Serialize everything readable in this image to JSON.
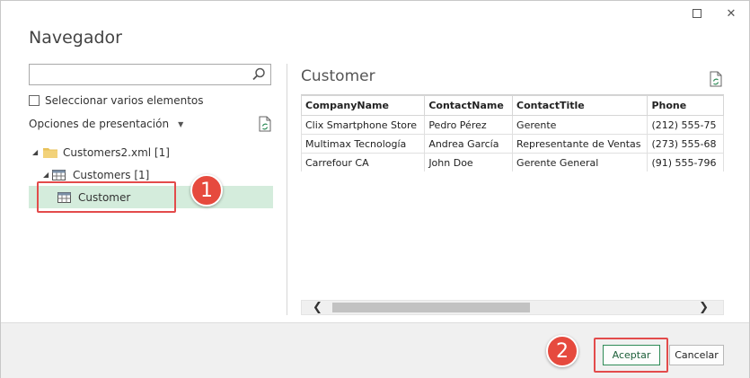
{
  "window": {
    "title": "Navegador",
    "controls": {
      "maximize_icon": "maximize-icon",
      "close_icon": "close-icon",
      "close_glyph": "✕"
    }
  },
  "left_panel": {
    "search": {
      "value": "",
      "placeholder": "",
      "icon": "search-icon"
    },
    "multi_select_label": "Seleccionar varios elementos",
    "options_label": "Opciones de presentación",
    "tree": [
      {
        "label": "Customers2.xml [1]",
        "icon": "folder-icon",
        "level": 1
      },
      {
        "label": "Customers [1]",
        "icon": "table-icon",
        "level": 2
      },
      {
        "label": "Customer",
        "icon": "table-icon",
        "level": 3,
        "selected": true
      }
    ]
  },
  "preview": {
    "title": "Customer",
    "columns": [
      "CompanyName",
      "ContactName",
      "ContactTitle",
      "Phone"
    ],
    "rows": [
      [
        "Clix Smartphone Store",
        "Pedro Pérez",
        "Gerente",
        "(212) 555-75"
      ],
      [
        "Multimax Tecnología",
        "Andrea García",
        "Representante de Ventas",
        "(273) 555-68"
      ],
      [
        "Carrefour CA",
        "John Doe",
        "Gerente General",
        "(91) 555-796"
      ]
    ],
    "scroll_left": "❮",
    "scroll_right": "❯"
  },
  "annotations": {
    "badge_1": "1",
    "badge_2": "2"
  },
  "footer": {
    "accept_label": "Aceptar",
    "cancel_label": "Cancelar"
  },
  "colors": {
    "accent": "#2e8b57",
    "selected_row": "#d4ecdc",
    "callout": "#e64a3e"
  }
}
